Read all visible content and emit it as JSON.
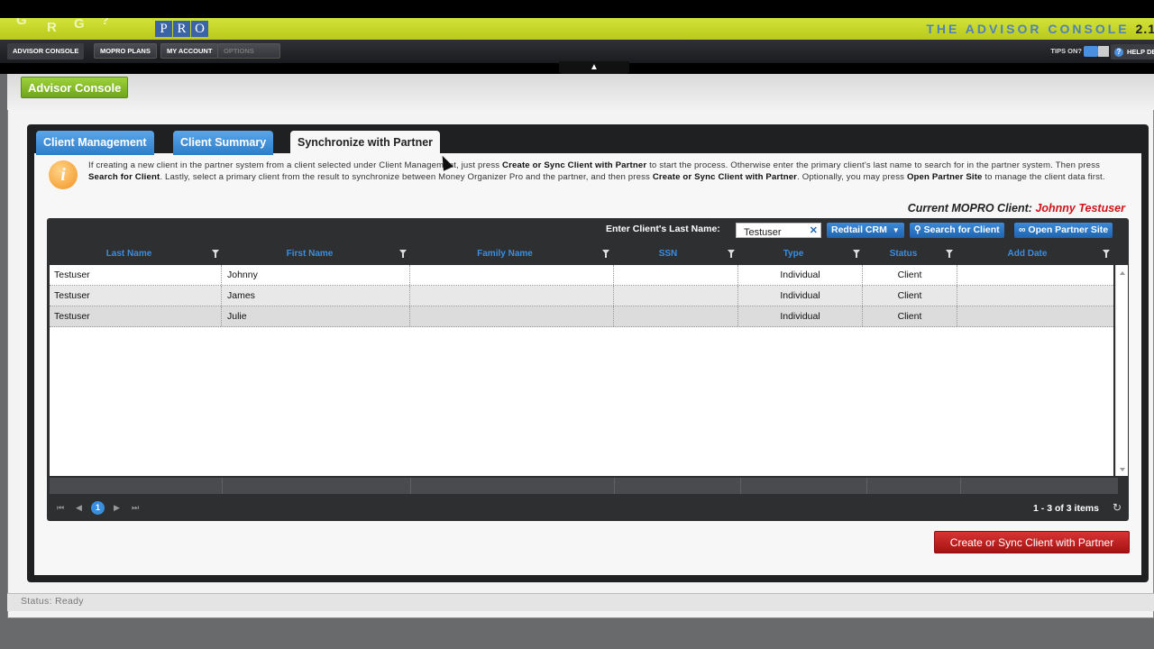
{
  "banner": {
    "logo_letters": [
      "G",
      "R",
      "G",
      "?"
    ],
    "pro_letters": [
      "P",
      "R",
      "O"
    ],
    "console_title": "THE ADVISOR CONSOLE",
    "version": "2.1"
  },
  "nav": {
    "items": [
      {
        "label": "ADVISOR CONSOLE"
      },
      {
        "label": "MOPRO PLANS"
      },
      {
        "label": "MY ACCOUNT"
      },
      {
        "label": "OPTIONS"
      }
    ],
    "tips_label": "TIPS ON?",
    "help_label": "HELP DE"
  },
  "page": {
    "title_button": "Advisor Console"
  },
  "tabs": [
    {
      "label": "Client Management",
      "active": false
    },
    {
      "label": "Client Summary",
      "active": false
    },
    {
      "label": "Synchronize with Partner",
      "active": true
    }
  ],
  "info": {
    "p1": "If creating a new client in the partner system from a client selected under Client Management, just press ",
    "b1": "Create or Sync Client with Partner",
    "p2": " to start the process. Otherwise enter the primary client's last name to search for in the partner system. Then press ",
    "b2": "Search for Client",
    "p3": ". Lastly, select a primary client from the result to synchronize between Money Organizer Pro and the partner, and then press ",
    "b3": "Create or Sync Client with Partner",
    "p4": ". Optionally, you may press ",
    "b4": "Open Partner Site",
    "p5": " to manage the client data first."
  },
  "current_client": {
    "label": "Current MOPRO Client:",
    "name": "Johnny Testuser"
  },
  "toolbar": {
    "search_label": "Enter Client's Last Name:",
    "search_value": "Testuser",
    "crm_label": "Redtail CRM",
    "search_button": "Search for Client",
    "open_site_button": "Open Partner Site"
  },
  "columns": [
    "Last Name",
    "First Name",
    "Family Name",
    "SSN",
    "Type",
    "Status",
    "Add Date"
  ],
  "rows": [
    {
      "last": "Testuser",
      "first": "Johnny",
      "family": "",
      "ssn": "",
      "type": "Individual",
      "status": "Client",
      "added": ""
    },
    {
      "last": "Testuser",
      "first": "James",
      "family": "",
      "ssn": "",
      "type": "Individual",
      "status": "Client",
      "added": ""
    },
    {
      "last": "Testuser",
      "first": "Julie",
      "family": "",
      "ssn": "",
      "type": "Individual",
      "status": "Client",
      "added": ""
    }
  ],
  "pager": {
    "current_page": "1",
    "items_text": "1 - 3 of 3 items"
  },
  "actions": {
    "create_button": "Create or Sync Client with Partner"
  },
  "status": {
    "text": "Status: Ready"
  }
}
